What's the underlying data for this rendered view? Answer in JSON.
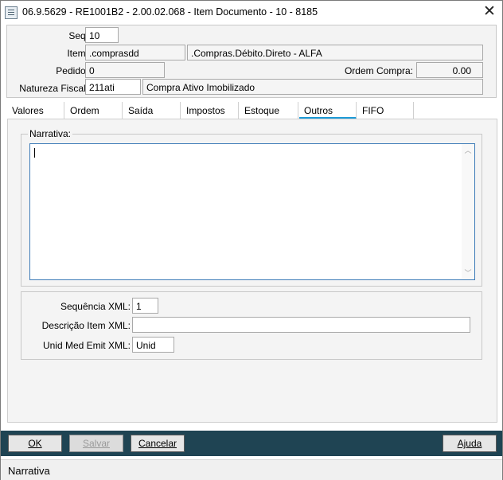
{
  "window": {
    "title": "06.9.5629 - RE1001B2 - 2.00.02.068 - Item Documento - 10 - 8185",
    "close_glyph": "✕"
  },
  "header": {
    "seq": {
      "label": "Seq:",
      "value": "10"
    },
    "item": {
      "label": "Item:",
      "code": ".comprasdd",
      "description": ".Compras.Débito.Direto - ALFA"
    },
    "pedido": {
      "label": "Pedido:",
      "value": "0"
    },
    "ordem_compra": {
      "label": "Ordem Compra:",
      "value": "0.00"
    },
    "natureza_fiscal": {
      "label": "Natureza Fiscal:",
      "code": "211ati",
      "description": "Compra Ativo Imobilizado"
    }
  },
  "tabs": [
    {
      "label": "Valores",
      "active": false
    },
    {
      "label": "Ordem",
      "active": false
    },
    {
      "label": "Saída",
      "active": false
    },
    {
      "label": "Impostos",
      "active": false
    },
    {
      "label": "Estoque",
      "active": false
    },
    {
      "label": "Outros",
      "active": true
    },
    {
      "label": "FIFO",
      "active": false
    }
  ],
  "outros": {
    "narrativa_label": "Narrativa:",
    "narrativa_value": "",
    "sequencia_xml": {
      "label": "Sequência XML:",
      "value": "1"
    },
    "descricao_item_xml": {
      "label": "Descrição Item XML:",
      "value": ""
    },
    "unid_med_emit_xml": {
      "label": "Unid Med Emit XML:",
      "value": "Unid"
    }
  },
  "footer": {
    "ok_label": "OK",
    "salvar_label": "Salvar",
    "cancelar_label": "Cancelar",
    "ajuda_label": "Ajuda"
  },
  "status_bar": {
    "text": "Narrativa"
  },
  "colors": {
    "footer_bg": "#1f4453",
    "active_tab_underline": "#1e9bd7",
    "textarea_border": "#3e7cb8"
  }
}
